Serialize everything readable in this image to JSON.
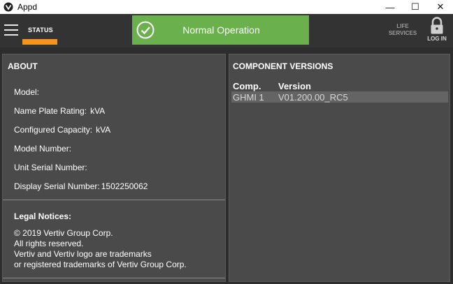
{
  "window": {
    "title": "Appd",
    "minimize_glyph": "—",
    "maximize_glyph": "☐",
    "close_glyph": "✕"
  },
  "header": {
    "status_tab": "STATUS",
    "operation_status": "Normal Operation",
    "life_services_line1": "LIFE",
    "life_services_line2": "SERVICES",
    "login_label": "LOG IN"
  },
  "about": {
    "title": "ABOUT",
    "fields": [
      {
        "label": "Model:",
        "value": ""
      },
      {
        "label": "Name Plate Rating:",
        "value": "kVA"
      },
      {
        "label": "Configured Capacity:",
        "value": "kVA"
      },
      {
        "label": "Model Number:",
        "value": ""
      },
      {
        "label": "Unit Serial Number:",
        "value": ""
      },
      {
        "label": "Display Serial Number:",
        "value": "1502250062"
      }
    ],
    "legal": {
      "title": "Legal Notices:",
      "lines": [
        "© 2019 Vertiv Group Corp.",
        "All rights reserved.",
        "Vertiv and Vertiv logo are trademarks",
        "or registered trademarks of Vertiv Group Corp."
      ]
    }
  },
  "components": {
    "title": "COMPONENT VERSIONS",
    "columns": [
      "Comp.",
      "Version"
    ],
    "rows": [
      {
        "comp": "GHMI 1",
        "version": "V01.200.00_RC5"
      }
    ]
  },
  "colors": {
    "accent_orange": "#f7941d",
    "status_green": "#6ab04c",
    "panel": "#4a4a4a",
    "background": "#2d2d2d"
  },
  "icons": [
    "app-icon",
    "menu-icon",
    "check-circle-icon",
    "lock-icon"
  ]
}
